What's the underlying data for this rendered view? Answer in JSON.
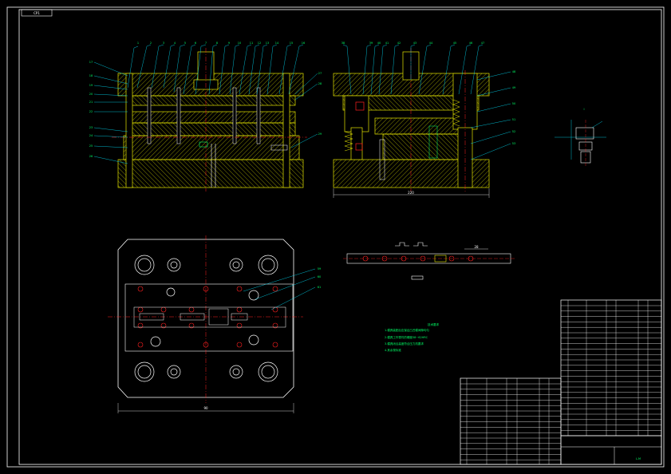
{
  "sheet": {
    "corner_tag": "CP1"
  },
  "views": {
    "front_view": {
      "balloons": [
        "1",
        "2",
        "3",
        "4",
        "5",
        "6",
        "7",
        "8",
        "9",
        "10",
        "11",
        "12",
        "13",
        "14",
        "15",
        "16",
        "17",
        "18",
        "19",
        "20",
        "21",
        "22",
        "23",
        "24",
        "25",
        "26",
        "27",
        "28",
        "29",
        "30",
        "31",
        "32",
        "33",
        "34",
        "35",
        "36",
        "37"
      ]
    },
    "side_view": {
      "balloons": [
        "38",
        "39",
        "40",
        "41",
        "42",
        "43",
        "44",
        "45",
        "46",
        "47",
        "48",
        "49",
        "50",
        "51",
        "52",
        "53",
        "54",
        "55",
        "56",
        "57",
        "58"
      ],
      "dim": "220"
    },
    "plan_view": {
      "dim": "90",
      "balloons": [
        "59",
        "60",
        "61"
      ]
    },
    "strip_layout": {
      "dim": "28"
    },
    "detail": {
      "label": "I"
    }
  },
  "tech_notes": {
    "title": "技术要求",
    "lines": [
      "1.模具装配后应保证凸凹模间隙均匀",
      "2.模具工作零件的硬度58~62HRC",
      "3.模具闭合高度符合压力机要求",
      "4.其余按标准"
    ]
  },
  "title_block": {
    "drawing_no": "L-M"
  },
  "colors": {
    "frame": "#ffffff",
    "outline": "#e6e600",
    "hatch": "#e6e600",
    "leader": "#00e5ff",
    "center": "#ff2020",
    "green": "#00ff66"
  }
}
